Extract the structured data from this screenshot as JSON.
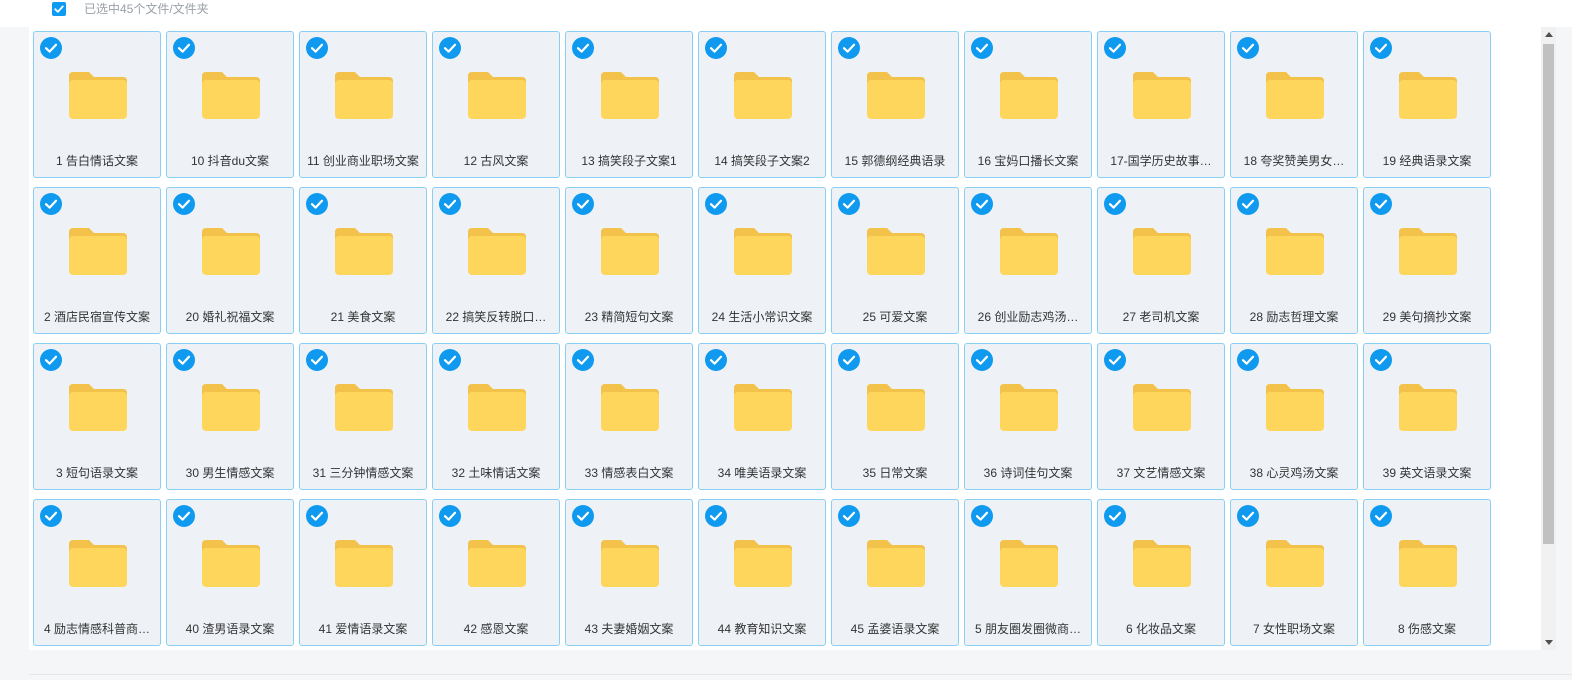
{
  "header": {
    "selected_text": "已选中45个文件/文件夹"
  },
  "colors": {
    "accent": "#0f9af0",
    "tile_border": "#89cff3",
    "tile_bg": "#eef2f7",
    "folder": "#ffd65c",
    "folder_back": "#f2c24b"
  },
  "icons": {
    "check": "check-circle-icon",
    "folder": "folder-icon"
  },
  "files": [
    {
      "name": "1 告白情话文案",
      "selected": true
    },
    {
      "name": "10 抖音du文案",
      "selected": true
    },
    {
      "name": "11 创业商业职场文案",
      "selected": true
    },
    {
      "name": "12 古风文案",
      "selected": true
    },
    {
      "name": "13 搞笑段子文案1",
      "selected": true
    },
    {
      "name": "14 搞笑段子文案2",
      "selected": true
    },
    {
      "name": "15 郭德纲经典语录",
      "selected": true
    },
    {
      "name": "16 宝妈口播长文案",
      "selected": true
    },
    {
      "name": "17-国学历史故事…",
      "selected": true
    },
    {
      "name": "18 夸奖赞美男女…",
      "selected": true
    },
    {
      "name": "19 经典语录文案",
      "selected": true
    },
    {
      "name": "2 酒店民宿宣传文案",
      "selected": true
    },
    {
      "name": "20 婚礼祝福文案",
      "selected": true
    },
    {
      "name": "21 美食文案",
      "selected": true
    },
    {
      "name": "22 搞笑反转脱口…",
      "selected": true
    },
    {
      "name": "23 精简短句文案",
      "selected": true
    },
    {
      "name": "24 生活小常识文案",
      "selected": true
    },
    {
      "name": "25 可爱文案",
      "selected": true
    },
    {
      "name": "26 创业励志鸡汤…",
      "selected": true
    },
    {
      "name": "27 老司机文案",
      "selected": true
    },
    {
      "name": "28 励志哲理文案",
      "selected": true
    },
    {
      "name": "29 美句摘抄文案",
      "selected": true
    },
    {
      "name": "3 短句语录文案",
      "selected": true
    },
    {
      "name": "30 男生情感文案",
      "selected": true
    },
    {
      "name": "31 三分钟情感文案",
      "selected": true
    },
    {
      "name": "32 土味情话文案",
      "selected": true
    },
    {
      "name": "33 情感表白文案",
      "selected": true
    },
    {
      "name": "34 唯美语录文案",
      "selected": true
    },
    {
      "name": "35 日常文案",
      "selected": true
    },
    {
      "name": "36 诗词佳句文案",
      "selected": true
    },
    {
      "name": "37 文艺情感文案",
      "selected": true
    },
    {
      "name": "38 心灵鸡汤文案",
      "selected": true
    },
    {
      "name": "39 英文语录文案",
      "selected": true
    },
    {
      "name": "4 励志情感科普商…",
      "selected": true
    },
    {
      "name": "40 渣男语录文案",
      "selected": true
    },
    {
      "name": "41 爱情语录文案",
      "selected": true
    },
    {
      "name": "42 感恩文案",
      "selected": true
    },
    {
      "name": "43 夫妻婚姻文案",
      "selected": true
    },
    {
      "name": "44 教育知识文案",
      "selected": true
    },
    {
      "name": "45 孟婆语录文案",
      "selected": true
    },
    {
      "name": "5 朋友圈发圈微商…",
      "selected": true
    },
    {
      "name": "6 化妆品文案",
      "selected": true
    },
    {
      "name": "7 女性职场文案",
      "selected": true
    },
    {
      "name": "8 伤感文案",
      "selected": true
    }
  ]
}
